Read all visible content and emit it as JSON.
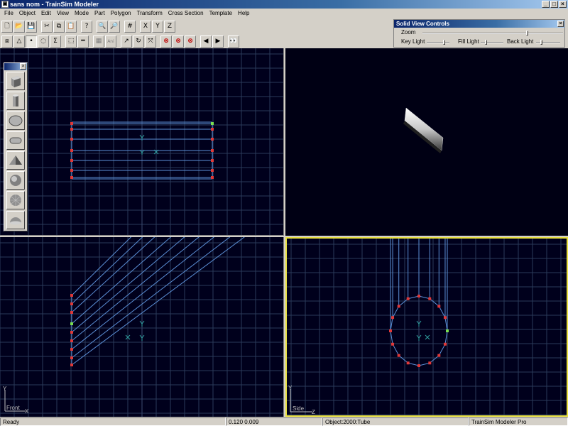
{
  "window": {
    "title": "sans nom - TrainSim Modeler",
    "buttons": [
      "_",
      "□",
      "×"
    ]
  },
  "menu": [
    "File",
    "Object",
    "Edit",
    "View",
    "Mode",
    "Part",
    "Polygon",
    "Transform",
    "Cross Section",
    "Template",
    "Help"
  ],
  "toolbar1": [
    {
      "name": "new-file-icon",
      "glyph": "🗋"
    },
    {
      "name": "open-folder-icon",
      "glyph": "📂"
    },
    {
      "name": "save-disk-icon",
      "glyph": "💾"
    },
    {
      "sep": true
    },
    {
      "name": "cut-icon",
      "glyph": "✂"
    },
    {
      "name": "copy-icon",
      "glyph": "⧉"
    },
    {
      "name": "paste-icon",
      "glyph": "📋"
    },
    {
      "sep": true
    },
    {
      "name": "help-icon",
      "glyph": "?"
    },
    {
      "sep": true
    },
    {
      "name": "zoom-icon",
      "glyph": "🔍"
    },
    {
      "name": "zoom-region-icon",
      "glyph": "🔎"
    },
    {
      "sep": true
    },
    {
      "name": "grid-icon",
      "glyph": "#"
    },
    {
      "sep": true
    },
    {
      "name": "axis-x-icon",
      "glyph": "X"
    },
    {
      "name": "axis-y-icon",
      "glyph": "Y"
    },
    {
      "name": "axis-z-icon",
      "glyph": "Z"
    }
  ],
  "toolbar2": [
    {
      "name": "select-part-icon",
      "glyph": "⧈"
    },
    {
      "name": "select-polygon-icon",
      "glyph": "△"
    },
    {
      "name": "select-point-icon",
      "glyph": "•",
      "pressed": true
    },
    {
      "name": "select-edge-icon",
      "glyph": "◌"
    },
    {
      "name": "sum-icon",
      "glyph": "Σ"
    },
    {
      "sep": true
    },
    {
      "name": "select-region-icon",
      "glyph": "⬚"
    },
    {
      "name": "ruler-icon",
      "glyph": "═"
    },
    {
      "sep": true
    },
    {
      "name": "texture-icon",
      "glyph": "▦",
      "grey": true
    },
    {
      "name": "animation-icon",
      "glyph": "Ani",
      "grey": true
    },
    {
      "sep": true
    },
    {
      "name": "move-icon",
      "glyph": "↗"
    },
    {
      "name": "rotate-icon",
      "glyph": "↻"
    },
    {
      "name": "scale-icon",
      "glyph": "⤧"
    },
    {
      "sep": true
    },
    {
      "name": "delete-icon",
      "glyph": "⊗",
      "red": true
    },
    {
      "name": "delete-polygon-icon",
      "glyph": "⊗",
      "red": true
    },
    {
      "name": "delete-part-icon",
      "glyph": "⊗",
      "red": true
    },
    {
      "sep": true
    },
    {
      "name": "previous-icon",
      "glyph": "◀"
    },
    {
      "name": "next-icon",
      "glyph": "▶"
    },
    {
      "sep": true
    },
    {
      "name": "binoculars-icon",
      "glyph": "👀"
    }
  ],
  "solid_view": {
    "title": "Solid View Controls",
    "zoom_label": "Zoom",
    "key_light_label": "Key Light",
    "fill_light_label": "Fill Light",
    "back_light_label": "Back Light",
    "zoom_level": 0.75,
    "key_light_level": 0.8,
    "fill_light_level": 0.2,
    "back_light_level": 0.2
  },
  "viewports": {
    "front_label": "Front",
    "side_label": "Side",
    "axis_y": "Y",
    "axis_x": "X",
    "axis_z": "Z"
  },
  "palette": [
    "box-primitive-icon",
    "cylinder-primitive-icon",
    "ellipse-primitive-icon",
    "tube-primitive-icon",
    "cone-primitive-icon",
    "sphere-primitive-icon",
    "geosphere-primitive-icon",
    "hemisphere-primitive-icon"
  ],
  "status": {
    "ready": "Ready",
    "coords": "0.120    0.009",
    "object": "Object:2000:Tube",
    "product": "TrainSim Modeler Pro"
  },
  "colors": {
    "viewport_bg": "#00001c",
    "grid": "#2a3a5a",
    "wire": "#5b8fd6",
    "vertex": "#e03838",
    "selected_vertex": "#7ae050",
    "active_border": "#e8e040"
  }
}
